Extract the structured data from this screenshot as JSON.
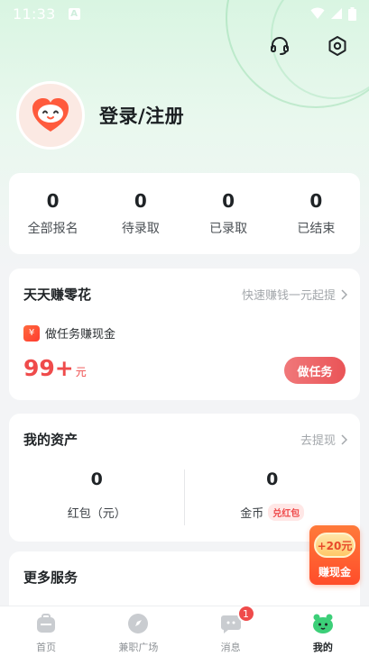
{
  "status_bar": {
    "time": "11:33",
    "app_badge": "A"
  },
  "profile": {
    "login_label": "登录/注册"
  },
  "stats": [
    {
      "count": "0",
      "label": "全部报名"
    },
    {
      "count": "0",
      "label": "待录取"
    },
    {
      "count": "0",
      "label": "已录取"
    },
    {
      "count": "0",
      "label": "已结束"
    }
  ],
  "earn_card": {
    "title": "天天赚零花",
    "more": "快速赚钱一元起提",
    "task_badge": "¥",
    "task_text": "做任务赚现金",
    "amount": "99",
    "amount_plus": "+",
    "amount_unit": "元",
    "button": "做任务"
  },
  "assets_card": {
    "title": "我的资产",
    "more": "去提现",
    "red_packet": {
      "value": "0",
      "label": "红包（元）"
    },
    "coins": {
      "value": "0",
      "label": "金币",
      "tag": "兑红包"
    }
  },
  "more_services": {
    "title": "更多服务"
  },
  "float_cash": {
    "coin": "+20元",
    "label": "赚现金"
  },
  "tabbar": {
    "items": [
      {
        "label": "首页"
      },
      {
        "label": "兼职广场"
      },
      {
        "label": "消息",
        "badge": "1"
      },
      {
        "label": "我的"
      }
    ]
  },
  "colors": {
    "accent": "#ef4b4b",
    "brand_green": "#3ccf78",
    "bg_top": "#d9f5e2"
  }
}
